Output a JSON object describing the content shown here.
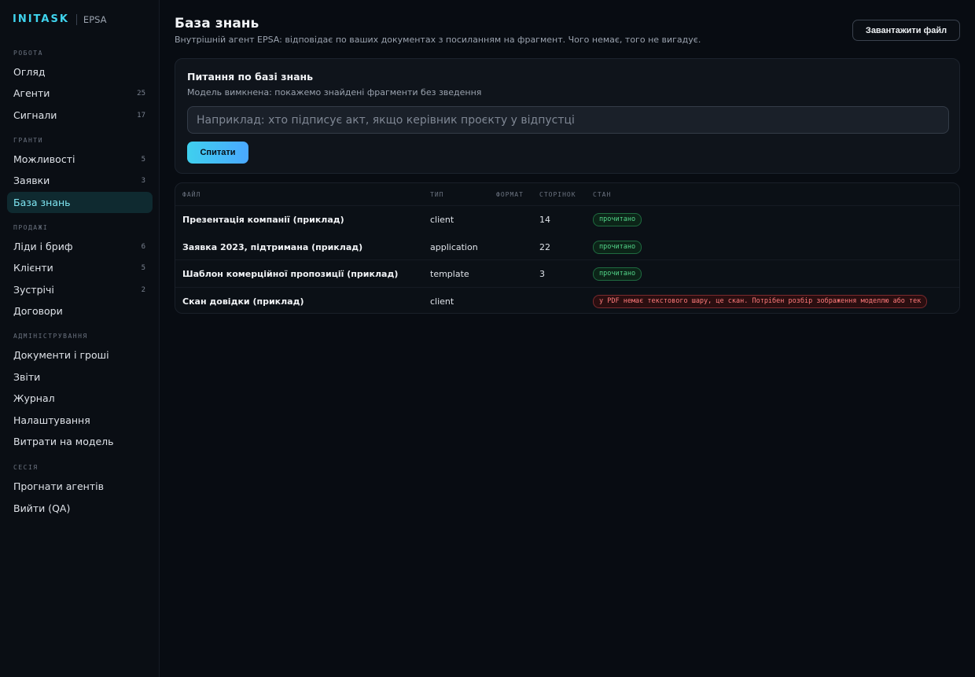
{
  "brand": {
    "name": "INITASK",
    "org": "EPSA"
  },
  "sidebar": {
    "sections": [
      {
        "title": "РОБОТА",
        "items": [
          {
            "label": "Огляд",
            "count": ""
          },
          {
            "label": "Агенти",
            "count": "25"
          },
          {
            "label": "Сигнали",
            "count": "17"
          }
        ]
      },
      {
        "title": "ГРАНТИ",
        "items": [
          {
            "label": "Можливості",
            "count": "5"
          },
          {
            "label": "Заявки",
            "count": "3"
          },
          {
            "label": "База знань",
            "count": "",
            "active": true
          }
        ]
      },
      {
        "title": "ПРОДАЖІ",
        "items": [
          {
            "label": "Ліди і бриф",
            "count": "6"
          },
          {
            "label": "Клієнти",
            "count": "5"
          },
          {
            "label": "Зустрічі",
            "count": "2"
          },
          {
            "label": "Договори",
            "count": ""
          }
        ]
      },
      {
        "title": "АДМІНІСТРУВАННЯ",
        "items": [
          {
            "label": "Документи і гроші",
            "count": ""
          },
          {
            "label": "Звіти",
            "count": ""
          },
          {
            "label": "Журнал",
            "count": ""
          },
          {
            "label": "Налаштування",
            "count": ""
          },
          {
            "label": "Витрати на модель",
            "count": ""
          }
        ]
      },
      {
        "title": "СЕСІЯ",
        "items": [
          {
            "label": "Прогнати агентів",
            "count": ""
          },
          {
            "label": "Вийти (QA)",
            "count": ""
          }
        ]
      }
    ]
  },
  "page": {
    "title": "База знань",
    "subtitle": "Внутрішній агент EPSA: відповідає по ваших документах з посиланням на фрагмент. Чого немає, того не вигадує.",
    "upload_label": "Завантажити файл"
  },
  "qa": {
    "title": "Питання по базі знань",
    "subtitle": "Модель вимкнена: покажемо знайдені фрагменти без зведення",
    "placeholder": "Наприклад: хто підписує акт, якщо керівник проєкту у відпустці",
    "value": "",
    "ask_label": "Спитати"
  },
  "table": {
    "columns": [
      "ФАЙЛ",
      "ТИП",
      "ФОРМАТ",
      "СТОРІНОК",
      "СТАН"
    ],
    "rows": [
      {
        "file": "Презентація компанії (приклад)",
        "type": "client",
        "format": "",
        "pages": "14",
        "status": "прочитано",
        "status_kind": "ok"
      },
      {
        "file": "Заявка 2023, підтримана (приклад)",
        "type": "application",
        "format": "",
        "pages": "22",
        "status": "прочитано",
        "status_kind": "ok"
      },
      {
        "file": "Шаблон комерційної пропозиції (приклад)",
        "type": "template",
        "format": "",
        "pages": "3",
        "status": "прочитано",
        "status_kind": "ok"
      },
      {
        "file": "Скан довідки (приклад)",
        "type": "client",
        "format": "",
        "pages": "",
        "status": "у PDF немає текстового шару, це скан. Потрібен розбір зображення моделлю або тек",
        "status_kind": "err"
      }
    ]
  },
  "colors": {
    "accent": "#3fd4ee",
    "ok": "#53d68a",
    "error": "#ff7a7a"
  }
}
